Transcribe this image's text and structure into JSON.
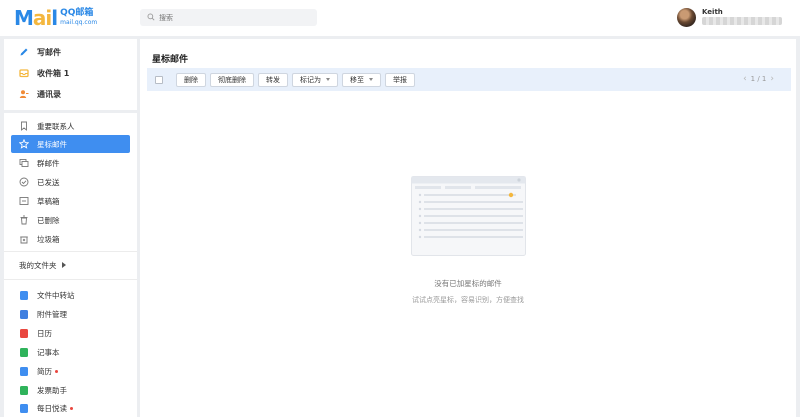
{
  "logo": {
    "big_prefix": "M",
    "big_ai": "ai",
    "big_suffix": "l",
    "cn": "QQ邮箱",
    "url": "mail.qq.com"
  },
  "search": {
    "placeholder": "搜索"
  },
  "user": {
    "name": "Keith"
  },
  "sidebar": {
    "primary": [
      {
        "label": "写邮件",
        "icon": "pencil-icon",
        "color": "#2a88e6"
      },
      {
        "label": "收件箱 1",
        "icon": "inbox-icon",
        "color": "#f4b73e"
      },
      {
        "label": "通讯录",
        "icon": "contacts-icon",
        "color": "#f08a36"
      }
    ],
    "folders": [
      {
        "label": "重要联系人",
        "icon": "bookmark-icon"
      },
      {
        "label": "星标邮件",
        "icon": "star-icon",
        "active": true
      },
      {
        "label": "群邮件",
        "icon": "group-mail-icon"
      },
      {
        "label": "已发送",
        "icon": "sent-icon"
      },
      {
        "label": "草稿箱",
        "icon": "draft-icon"
      },
      {
        "label": "已删除",
        "icon": "trash-icon"
      },
      {
        "label": "垃圾箱",
        "icon": "spam-icon"
      }
    ],
    "my_folders": "我的文件夹",
    "apps": [
      {
        "label": "文件中转站",
        "icon": "file-transfer-icon",
        "color": "#3f8ef0"
      },
      {
        "label": "附件管理",
        "icon": "attachment-icon",
        "color": "#3f7fe0"
      },
      {
        "label": "日历",
        "icon": "calendar-icon",
        "color": "#e9473f"
      },
      {
        "label": "记事本",
        "icon": "notepad-icon",
        "color": "#2fb35b"
      },
      {
        "label": "简历",
        "icon": "resume-icon",
        "color": "#3f8ef0",
        "dot": true
      },
      {
        "label": "发票助手",
        "icon": "invoice-icon",
        "color": "#2fb35b"
      },
      {
        "label": "每日悦读",
        "icon": "reading-icon",
        "color": "#3f8ef0",
        "dot": true
      }
    ]
  },
  "main": {
    "title": "星标邮件",
    "toolbar": {
      "delete": "删除",
      "delete_permanently": "彻底删除",
      "forward": "转发",
      "mark_as": "标记为",
      "move_to": "移至",
      "report": "举报"
    },
    "pager": {
      "text": "1 / 1"
    },
    "empty_title": "没有已加星标的邮件",
    "empty_sub": "试试点亮星标，容易识别，方便查找"
  },
  "colors": {
    "accent": "#3f8ef0",
    "toolbar_bg": "#e8f0fb",
    "star": "#f4b73e"
  }
}
